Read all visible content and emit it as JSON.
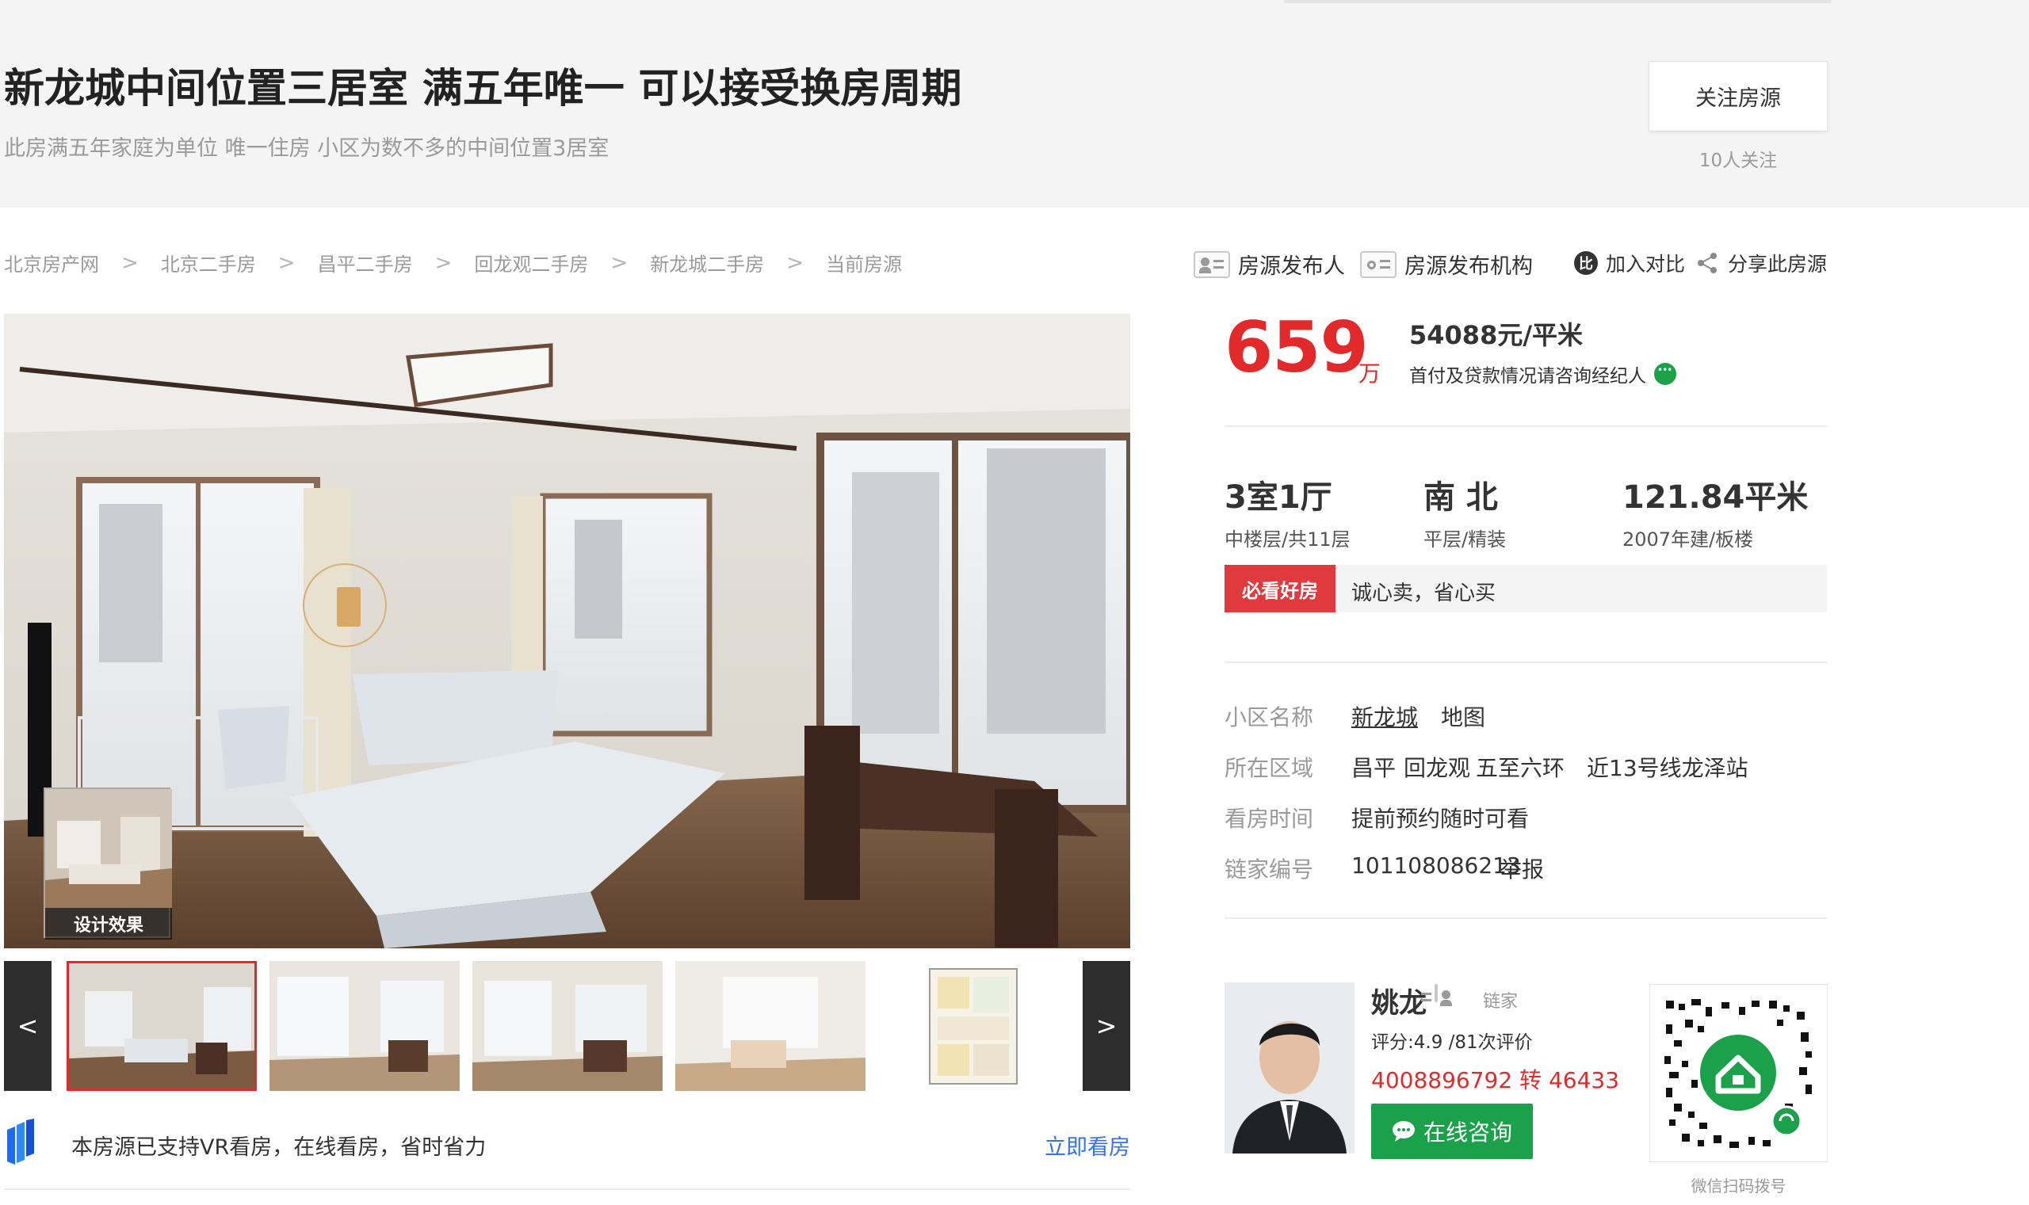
{
  "header": {
    "title": "新龙城中间位置三居室 满五年唯一 可以接受换房周期",
    "subtitle": "此房满五年家庭为单位 唯一住房 小区为数不多的中间位置3居室",
    "follow_label": "关注房源",
    "follow_count": "10人关注"
  },
  "breadcrumb": {
    "items": [
      "北京房产网",
      "北京二手房",
      "昌平二手房",
      "回龙观二手房",
      "新龙城二手房",
      "当前房源"
    ],
    "separator": ">"
  },
  "actions": {
    "publisher": "房源发布人",
    "agency": "房源发布机构",
    "compare": "加入对比",
    "compare_icon_glyph": "比",
    "share": "分享此房源"
  },
  "gallery": {
    "badge_label": "设计效果",
    "prev": "<",
    "next": ">",
    "vr_text": "本房源已支持VR看房，在线看房，省时省力",
    "vr_link": "立即看房"
  },
  "price": {
    "total": "659",
    "unit": "万",
    "unit_price": "54088元/平米",
    "payment_tip": "首付及贷款情况请咨询经纪人"
  },
  "specs": [
    {
      "main": "3室1厅",
      "sub": "中楼层/共11层"
    },
    {
      "main": "南 北",
      "sub": "平层/精装"
    },
    {
      "main": "121.84平米",
      "sub": "2007年建/板楼"
    }
  ],
  "tag": {
    "badge": "必看好房",
    "text": "诚心卖，省心买"
  },
  "info": {
    "community_label": "小区名称",
    "community_value": "新龙城",
    "map_link": "地图",
    "area_label": "所在区域",
    "area_district": "昌平",
    "area_sub": "回龙观",
    "area_ring": "五至六环",
    "area_subway": "近13号线龙泽站",
    "viewing_label": "看房时间",
    "viewing_value": "提前预约随时可看",
    "id_label": "链家编号",
    "id_value": "101108086213",
    "report_link": "举报"
  },
  "agent": {
    "name": "姚龙",
    "brand": "链家",
    "rating": "评分:4.9 /81次评价",
    "phone": "4008896792 转 46433",
    "consult": "在线咨询",
    "qr_caption": "微信扫码拨号"
  },
  "colors": {
    "price_red": "#e22a2a",
    "badge_red": "#e0393e",
    "wechat_green": "#1aa14a",
    "link_blue": "#3072f6",
    "header_bg": "#f4f4f4"
  }
}
